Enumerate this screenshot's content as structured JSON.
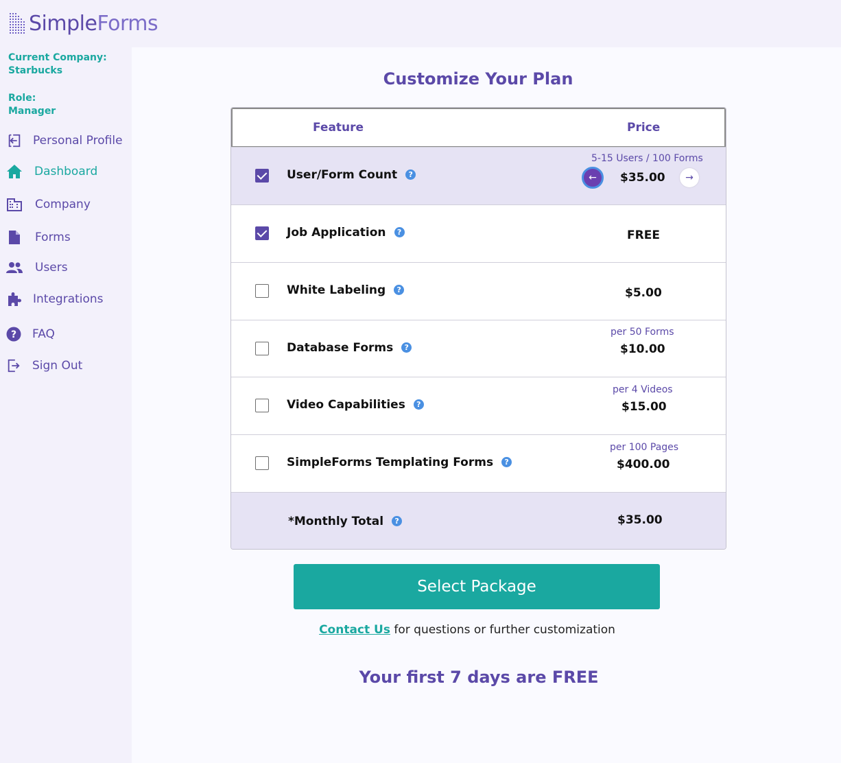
{
  "brand": {
    "name_a": "Simple",
    "name_b": "Forms"
  },
  "sidebar": {
    "company_label": "Current Company:",
    "company_value": "Starbucks",
    "role_label": "Role:",
    "role_value": "Manager",
    "items": [
      {
        "label": "Personal Profile",
        "icon": "profile-icon",
        "active": false
      },
      {
        "label": "Dashboard",
        "icon": "home-icon",
        "active": true
      },
      {
        "label": "Company",
        "icon": "building-icon",
        "active": false
      },
      {
        "label": "Forms",
        "icon": "document-icon",
        "active": false
      },
      {
        "label": "Users",
        "icon": "users-icon",
        "active": false
      },
      {
        "label": "Integrations",
        "icon": "puzzle-icon",
        "active": false
      },
      {
        "label": "FAQ",
        "icon": "question-icon",
        "active": false
      },
      {
        "label": "Sign Out",
        "icon": "sign-out-icon",
        "active": false
      }
    ]
  },
  "main": {
    "title": "Customize Your Plan",
    "table": {
      "header_feature": "Feature",
      "header_price": "Price",
      "rows": [
        {
          "label": "User/Form Count",
          "checked": true,
          "sub": "5-15 Users / 100 Forms",
          "price": "$35.00"
        },
        {
          "label": "Job Application",
          "checked": true,
          "sub": "",
          "price": "FREE"
        },
        {
          "label": "White Labeling",
          "checked": false,
          "sub": "",
          "price": "$5.00"
        },
        {
          "label": "Database Forms",
          "checked": false,
          "sub": "per 50 Forms",
          "price": "$10.00"
        },
        {
          "label": "Video Capabilities",
          "checked": false,
          "sub": "per 4 Videos",
          "price": "$15.00"
        },
        {
          "label": "SimpleForms Templating Forms",
          "checked": false,
          "sub": "per 100 Pages",
          "price": "$400.00"
        }
      ],
      "total_label": "*Monthly Total",
      "total_price": "$35.00"
    },
    "select_button": "Select Package",
    "contact_link": "Contact Us",
    "contact_text": " for questions or further customization",
    "trial_text": "Your first 7 days are FREE"
  },
  "colors": {
    "purple": "#5b49a8",
    "teal": "#1aa8a0",
    "help_blue": "#4a90e2"
  }
}
